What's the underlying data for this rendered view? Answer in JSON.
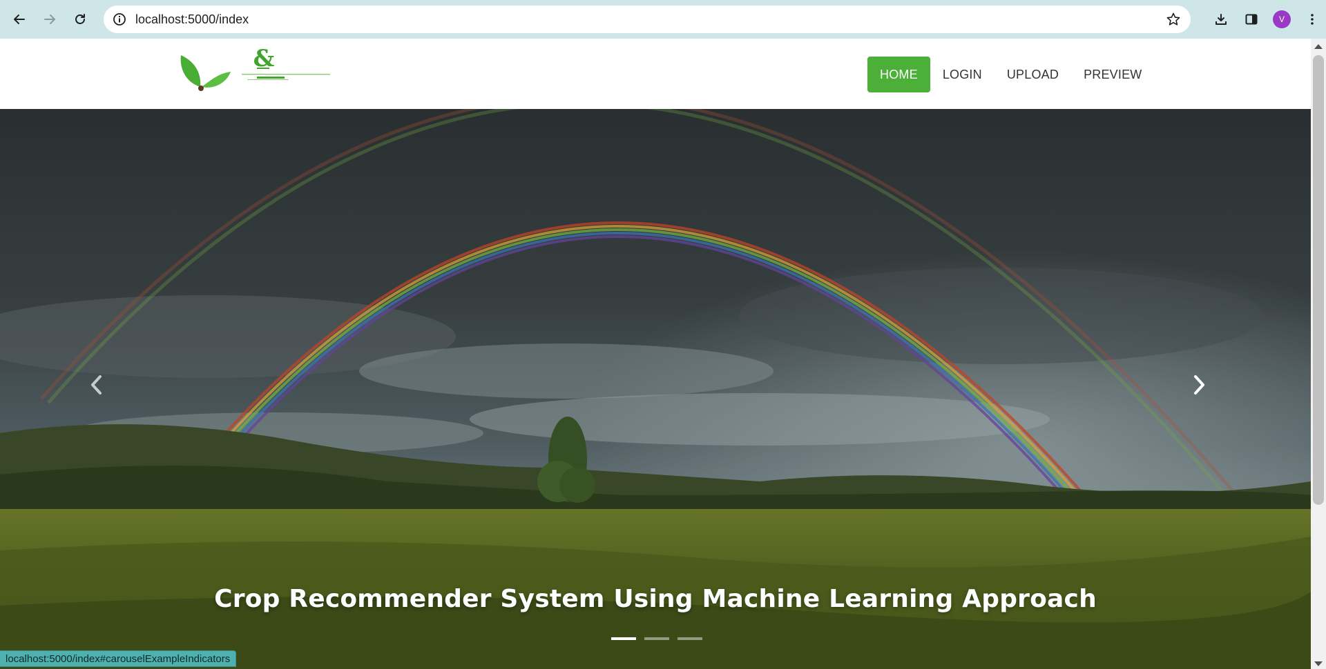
{
  "browser": {
    "url": "localhost:5000/index",
    "avatar_letter": "V",
    "accent_color": "#cfe6e8",
    "icons": [
      "back-arrow-icon",
      "forward-arrow-icon",
      "reload-icon",
      "site-info-icon",
      "bookmark-star-icon",
      "download-icon",
      "side-panel-icon",
      "menu-dots-icon"
    ]
  },
  "site": {
    "logo_glyph": "&",
    "menu": [
      {
        "label": "HOME",
        "active": true
      },
      {
        "label": "LOGIN",
        "active": false
      },
      {
        "label": "UPLOAD",
        "active": false
      },
      {
        "label": "PREVIEW",
        "active": false
      }
    ],
    "active_color": "#4cb038"
  },
  "hero": {
    "caption": "Crop Recommender System Using Machine Learning Approach",
    "slides_total": 3,
    "active_slide": 1
  },
  "status_bar": {
    "text": "localhost:5000/index#carouselExampleIndicators"
  }
}
